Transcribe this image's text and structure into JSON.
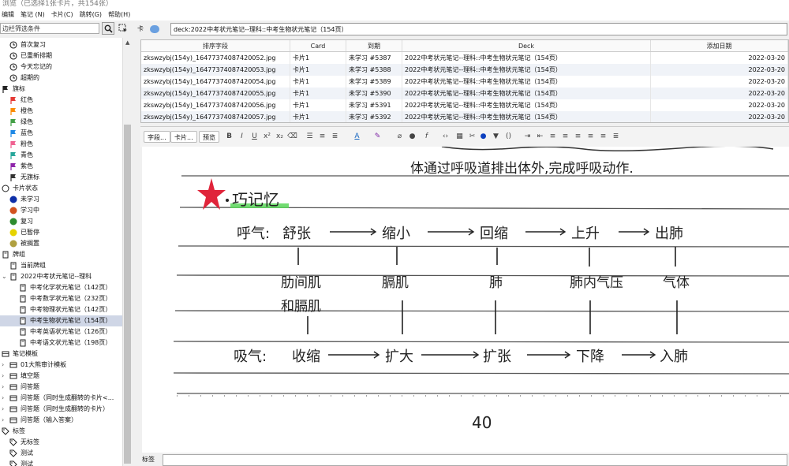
{
  "window": {
    "title": "浏览（已选择1张卡片，共154张）"
  },
  "menu": [
    "编辑",
    "笔记 (N)",
    "卡片(C)",
    "跳转(G)",
    "帮助(H)"
  ],
  "sidebar": {
    "search_placeholder": "边栏筛选条件",
    "items": [
      {
        "label": "首次复习",
        "icon": "clock-icon",
        "indent": 1
      },
      {
        "label": "已重新排期",
        "icon": "clock-icon",
        "indent": 1
      },
      {
        "label": "今天忘记的",
        "icon": "clock-icon",
        "indent": 1
      },
      {
        "label": "超期的",
        "icon": "clock-icon",
        "indent": 1
      },
      {
        "label": "旗标",
        "icon": "flag-icon",
        "indent": 0,
        "color": "#222222"
      },
      {
        "label": "红色",
        "icon": "flag-icon",
        "indent": 1,
        "color": "#e53935"
      },
      {
        "label": "橙色",
        "icon": "flag-icon",
        "indent": 1,
        "color": "#fb8c00"
      },
      {
        "label": "绿色",
        "icon": "flag-icon",
        "indent": 1,
        "color": "#43a047"
      },
      {
        "label": "蓝色",
        "icon": "flag-icon",
        "indent": 1,
        "color": "#1e88e5"
      },
      {
        "label": "粉色",
        "icon": "flag-icon",
        "indent": 1,
        "color": "#f06292"
      },
      {
        "label": "青色",
        "icon": "flag-icon",
        "indent": 1,
        "color": "#26a69a"
      },
      {
        "label": "紫色",
        "icon": "flag-icon",
        "indent": 1,
        "color": "#8e24aa"
      },
      {
        "label": "无旗标",
        "icon": "flag-icon",
        "indent": 1,
        "color": "#333333"
      },
      {
        "label": "卡片状态",
        "icon": "circle-icon",
        "indent": 0,
        "color": "#ffffff"
      },
      {
        "label": "未学习",
        "icon": "circle-icon",
        "indent": 1,
        "color": "#0d2ea8"
      },
      {
        "label": "学习中",
        "icon": "circle-icon",
        "indent": 1,
        "color": "#d2521e"
      },
      {
        "label": "复习",
        "icon": "circle-icon",
        "indent": 1,
        "color": "#2e8b2e"
      },
      {
        "label": "已暂停",
        "icon": "circle-icon",
        "indent": 1,
        "color": "#e6d300"
      },
      {
        "label": "被搁置",
        "icon": "circle-icon",
        "indent": 1,
        "color": "#b0a040"
      },
      {
        "label": "牌组",
        "icon": "deck-icon",
        "indent": 0
      },
      {
        "label": "当前牌组",
        "icon": "deck-icon",
        "indent": 1
      },
      {
        "label": "2022中考状元笔记--理科",
        "icon": "deck-icon",
        "indent": 1,
        "chevron": "⌄"
      },
      {
        "label": "中考化学状元笔记（142页）",
        "icon": "deck-icon",
        "indent": 2
      },
      {
        "label": "中考数学状元笔记（232页）",
        "icon": "deck-icon",
        "indent": 2
      },
      {
        "label": "中考物理状元笔记（142页）",
        "icon": "deck-icon",
        "indent": 2
      },
      {
        "label": "中考生物状元笔记（154页）",
        "icon": "deck-icon",
        "indent": 2,
        "selected": true
      },
      {
        "label": "中考英语状元笔记（126页）",
        "icon": "deck-icon",
        "indent": 2
      },
      {
        "label": "中考语文状元笔记（198页）",
        "icon": "deck-icon",
        "indent": 2
      },
      {
        "label": "笔记模板",
        "icon": "notetype-icon",
        "indent": 0
      },
      {
        "label": "01大熊审计模板",
        "icon": "notetype-icon",
        "indent": 1,
        "chevron": "›"
      },
      {
        "label": "填空题",
        "icon": "notetype-icon",
        "indent": 1,
        "chevron": "›"
      },
      {
        "label": "问答题",
        "icon": "notetype-icon",
        "indent": 1,
        "chevron": "›"
      },
      {
        "label": "问答题（同时生成翻转的卡片<...",
        "icon": "notetype-icon",
        "indent": 1,
        "chevron": "›"
      },
      {
        "label": "问答题（同时生成翻转的卡片）",
        "icon": "notetype-icon",
        "indent": 1,
        "chevron": "›"
      },
      {
        "label": "问答题（输入答案）",
        "icon": "notetype-icon",
        "indent": 1,
        "chevron": "›"
      },
      {
        "label": "标签",
        "icon": "tag-icon",
        "indent": 0
      },
      {
        "label": "无标签",
        "icon": "tag-icon",
        "indent": 1
      },
      {
        "label": "测试",
        "icon": "tag-icon",
        "indent": 1
      },
      {
        "label": "测试",
        "icon": "tag-icon",
        "indent": 1
      }
    ]
  },
  "filter": {
    "mode_label": "卡",
    "search_value": "deck:2022中考状元笔记--理科::中考生物状元笔记（154页）"
  },
  "table": {
    "columns": [
      "排序字段",
      "Card",
      "到期",
      "Deck",
      "添加日期"
    ],
    "rows": [
      [
        "zkswzybj(154y)_16477374087420052.jpg",
        "卡片1",
        "未学习 #5387",
        "2022中考状元笔记--理科::中考生物状元笔记（154页）",
        "2022-03-20"
      ],
      [
        "zkswzybj(154y)_16477374087420053.jpg",
        "卡片1",
        "未学习 #5388",
        "2022中考状元笔记--理科::中考生物状元笔记（154页）",
        "2022-03-20"
      ],
      [
        "zkswzybj(154y)_16477374087420054.jpg",
        "卡片1",
        "未学习 #5389",
        "2022中考状元笔记--理科::中考生物状元笔记（154页）",
        "2022-03-20"
      ],
      [
        "zkswzybj(154y)_16477374087420055.jpg",
        "卡片1",
        "未学习 #5390",
        "2022中考状元笔记--理科::中考生物状元笔记（154页）",
        "2022-03-20"
      ],
      [
        "zkswzybj(154y)_16477374087420056.jpg",
        "卡片1",
        "未学习 #5391",
        "2022中考状元笔记--理科::中考生物状元笔记（154页）",
        "2022-03-20"
      ],
      [
        "zkswzybj(154y)_16477374087420057.jpg",
        "卡片1",
        "未学习 #5392",
        "2022中考状元笔记--理科::中考生物状元笔记（154页）",
        "2022-03-20"
      ]
    ]
  },
  "editor": {
    "fields_button": "字段...",
    "cards_button": "卡片...",
    "preview_button": "预览"
  },
  "note_image": {
    "line1": "体通过呼吸道排出体外,完成呼吸动作.",
    "heading": "巧记忆",
    "exhale_label": "呼气:",
    "exhale_steps": [
      "舒张",
      "缩小",
      "回缩",
      "上升",
      "出肺"
    ],
    "column_labels": [
      "肋间肌",
      "膈肌",
      "肺",
      "肺内气压",
      "气体"
    ],
    "column_label_extra": "和膈肌",
    "inhale_label": "吸气:",
    "inhale_steps": [
      "收缩",
      "扩大",
      "扩张",
      "下降",
      "入肺"
    ],
    "page_number": "40"
  },
  "tags": {
    "label": "标签"
  }
}
